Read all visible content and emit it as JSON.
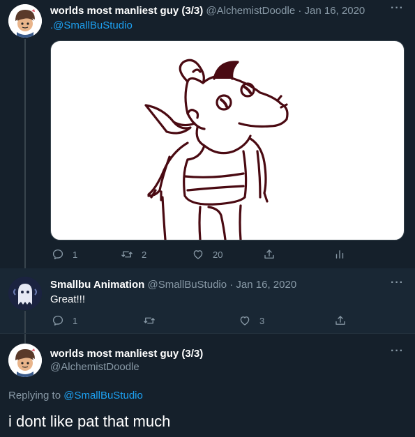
{
  "tweet1": {
    "name": "worlds most manliest guy (3/3)",
    "handle": "@AlchemistDoodle",
    "date": "· Jan 16, 2020",
    "text_prefix": ".",
    "text_mention": "@SmallBuStudio",
    "actions": {
      "reply": "1",
      "retweet": "2",
      "like": "20"
    },
    "more_icon": "more-icon"
  },
  "tweet2": {
    "name": "Smallbu Animation",
    "handle": "@SmallBuStudio",
    "date": "· Jan 16, 2020",
    "text": "Great!!!",
    "actions": {
      "reply": "1",
      "retweet": "",
      "like": "3"
    }
  },
  "tweet3": {
    "name": "worlds most manliest guy (3/3)",
    "handle": "@AlchemistDoodle",
    "replying_label": "Replying to",
    "replying_to": "@SmallBuStudio",
    "text": "i dont like pat that much"
  },
  "colors": {
    "background": "#15202b",
    "secondary_text": "#8899a6",
    "link": "#1da1f2",
    "drawing": "#4a0a12"
  }
}
